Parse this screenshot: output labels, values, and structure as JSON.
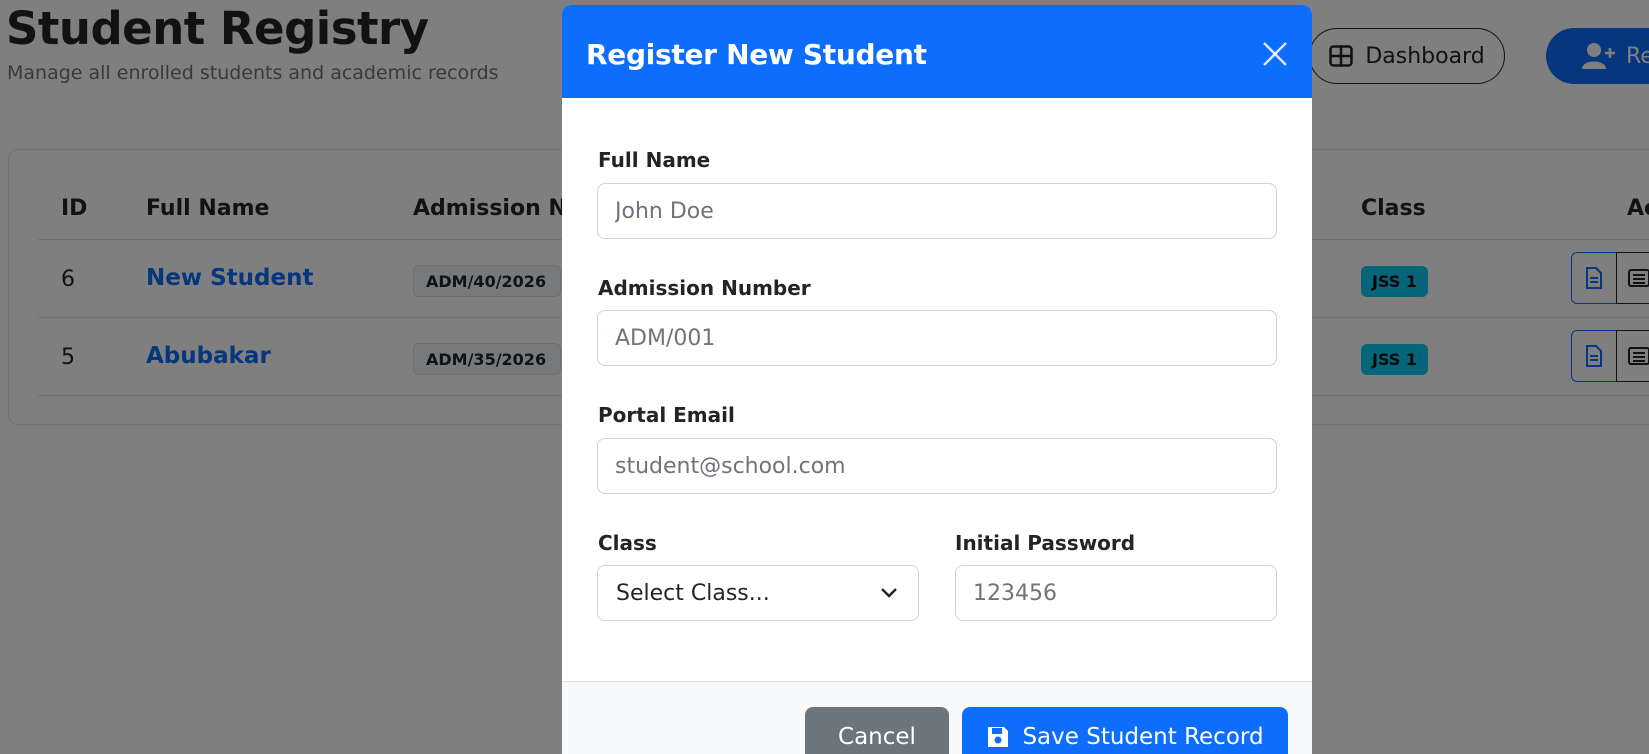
{
  "page": {
    "title": "Student Registry",
    "subtitle": "Manage all enrolled students and academic records",
    "dashboard_label": "Dashboard",
    "register_label": "Re"
  },
  "table": {
    "headers": {
      "id": "ID",
      "full_name": "Full Name",
      "admission_no": "Admission No",
      "class": "Class",
      "actions": "Ac"
    },
    "rows": [
      {
        "id": "6",
        "name": "New Student",
        "admission": "ADM/40/2026",
        "class": "JSS 1"
      },
      {
        "id": "5",
        "name": "Abubakar",
        "admission": "ADM/35/2026",
        "class": "JSS 1"
      }
    ]
  },
  "modal": {
    "title": "Register New Student",
    "fields": {
      "full_name": {
        "label": "Full Name",
        "placeholder": "John Doe"
      },
      "admission_number": {
        "label": "Admission Number",
        "placeholder": "ADM/001"
      },
      "portal_email": {
        "label": "Portal Email",
        "placeholder": "student@school.com"
      },
      "class": {
        "label": "Class",
        "selected": "Select Class..."
      },
      "initial_password": {
        "label": "Initial Password",
        "placeholder": "123456"
      }
    },
    "cancel_label": "Cancel",
    "save_label": "Save Student Record"
  },
  "icons": {
    "dashboard": "grid-icon",
    "register": "person-plus-icon",
    "close": "close-icon",
    "save": "floppy-disk-icon",
    "chevron": "chevron-down-icon",
    "document": "document-icon",
    "list": "list-icon"
  },
  "colors": {
    "primary": "#0d6efd",
    "secondary": "#6c757d",
    "info": "#0dcaf0",
    "overlay": "rgba(0,0,0,0.5)"
  }
}
